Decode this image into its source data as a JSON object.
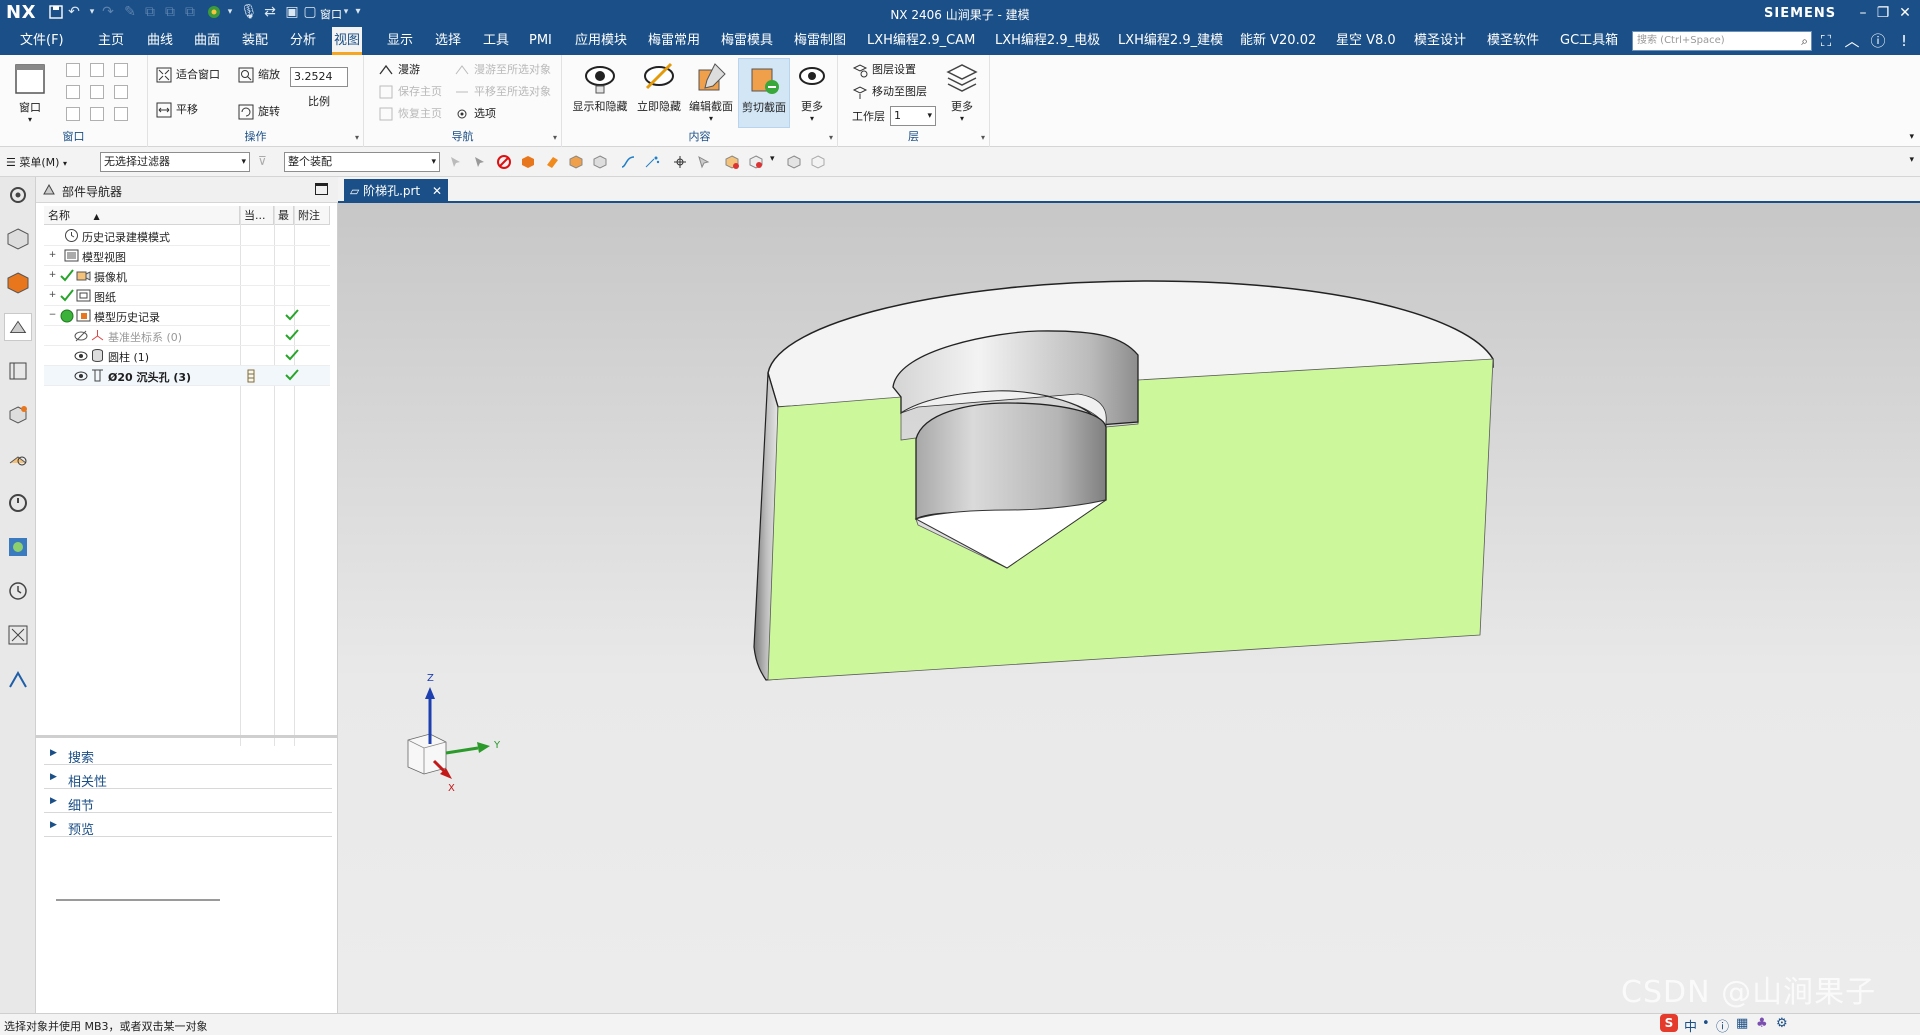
{
  "titlebar": {
    "logo": "NX",
    "window_label": "窗口",
    "title": "NX 2406 山涧果子 - 建模",
    "brand": "SIEMENS"
  },
  "menubar": {
    "tabs": [
      "文件(F)",
      "主页",
      "曲线",
      "曲面",
      "装配",
      "分析",
      "视图",
      "显示",
      "选择",
      "工具",
      "PMI",
      "应用模块",
      "梅雷常用",
      "梅雷模具",
      "梅雷制图",
      "LXH编程2.9_CAM",
      "LXH编程2.9_电极",
      "LXH编程2.9_建模",
      "能新 V20.02",
      "星空 V8.0",
      "模圣设计",
      "模圣软件",
      "GC工具箱"
    ],
    "active_tab": "视图",
    "search_placeholder": "搜索 (Ctrl+Space)"
  },
  "ribbon": {
    "window_group": {
      "label": "窗口",
      "button": "窗口"
    },
    "operate_group": {
      "label": "操作",
      "fit": "适合窗口",
      "zoom": "缩放",
      "scale_value": "3.2524",
      "scale_label": "比例",
      "pan": "平移",
      "rotate": "旋转"
    },
    "nav_group": {
      "label": "导航",
      "items": [
        "漫游",
        "保存主页",
        "恢复主页",
        "漫游至所选对象",
        "平移至所选对象",
        "选项"
      ]
    },
    "content_group": {
      "label": "内容",
      "buttons": [
        "显示和隐藏",
        "立即隐藏",
        "编辑截面",
        "剪切截面",
        "更多"
      ]
    },
    "layer_group": {
      "label": "层",
      "layer_settings": "图层设置",
      "move_to_layer": "移动至图层",
      "work_layer_label": "工作层",
      "work_layer_value": "1",
      "more": "更多"
    }
  },
  "toolbar2": {
    "menu_label": "菜单(M)",
    "filter_value": "无选择过滤器",
    "scope_value": "整个装配"
  },
  "navigator": {
    "title": "部件导航器",
    "columns": [
      "名称",
      "当...",
      "最",
      "附注"
    ],
    "rows": [
      {
        "label": "历史记录建模模式"
      },
      {
        "label": "模型视图"
      },
      {
        "label": "摄像机"
      },
      {
        "label": "图纸"
      },
      {
        "label": "模型历史记录"
      },
      {
        "label": "基准坐标系 (0)"
      },
      {
        "label": "圆柱 (1)"
      },
      {
        "label": "Ø20 沉头孔 (3)"
      }
    ],
    "panels": [
      "搜索",
      "相关性",
      "细节",
      "预览"
    ]
  },
  "file_tab": {
    "label": "阶梯孔.prt"
  },
  "viewport": {
    "axis_z": "Z",
    "axis_y": "Y",
    "axis_x": "X",
    "section_color": "#ccf79a",
    "watermark": "CSDN @山涧果子"
  },
  "status": {
    "message": "选择对象并使用 MB3，或者双击某一对象",
    "ime_chars": [
      "中",
      "•",
      "ⓘ",
      "▦",
      "♣",
      "⚙"
    ]
  }
}
